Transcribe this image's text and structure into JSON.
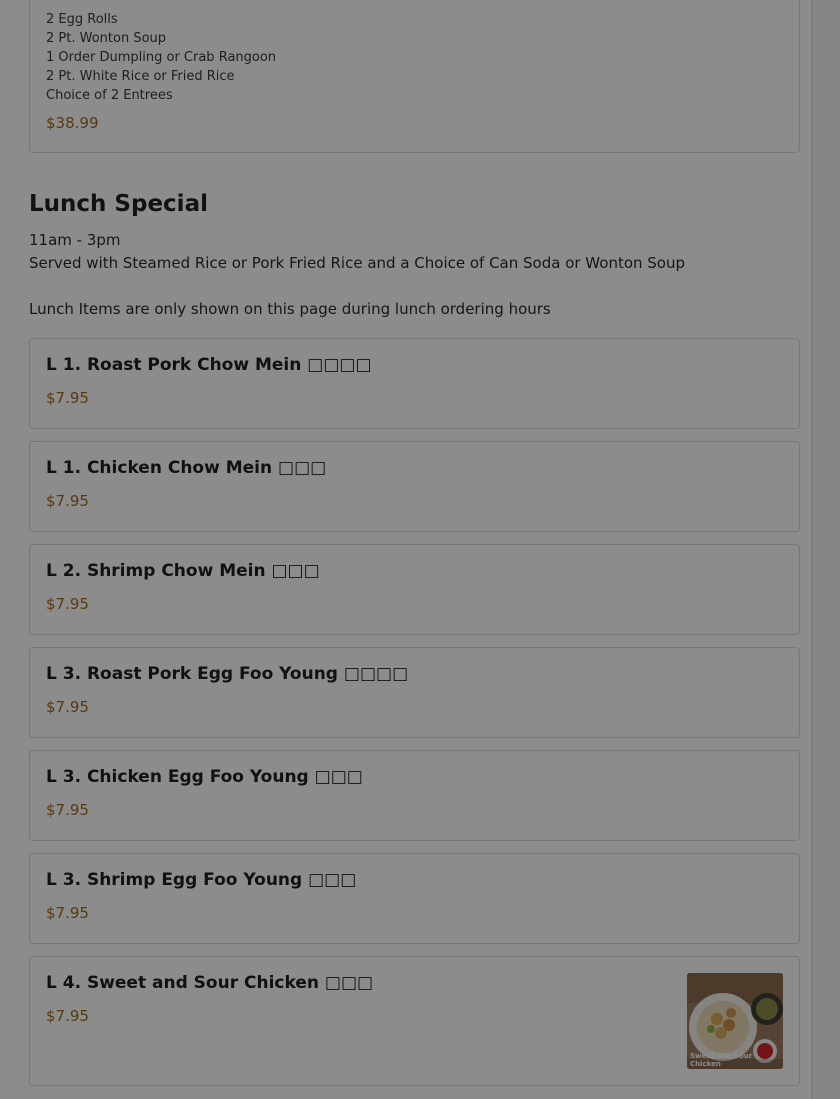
{
  "combo": {
    "lines": [
      "2 Egg Rolls",
      "2 Pt. Wonton Soup",
      "1 Order Dumpling or Crab Rangoon",
      "2 Pt. White Rice or Fried Rice",
      "Choice of 2 Entrees"
    ],
    "price": "$38.99"
  },
  "section": {
    "title": "Lunch Special",
    "hours": "11am - 3pm",
    "served": "Served with Steamed Rice or Pork Fried Rice and a Choice of Can Soda or Wonton Soup",
    "note": "Lunch Items are only shown on this page during lunch ordering hours"
  },
  "items": [
    {
      "name": "L 1. Roast Pork Chow Mein □□□□",
      "price": "$7.95"
    },
    {
      "name": "L 1. Chicken Chow Mein □□□",
      "price": "$7.95"
    },
    {
      "name": "L 2. Shrimp Chow Mein □□□",
      "price": "$7.95"
    },
    {
      "name": "L 3. Roast Pork Egg Foo Young □□□□",
      "price": "$7.95"
    },
    {
      "name": "L 3. Chicken Egg Foo Young □□□",
      "price": "$7.95"
    },
    {
      "name": "L 3. Shrimp Egg Foo Young □□□",
      "price": "$7.95"
    },
    {
      "name": "L 4. Sweet and Sour Chicken □□□",
      "price": "$7.95",
      "image_caption": "Sweet and Sour Chicken"
    }
  ]
}
